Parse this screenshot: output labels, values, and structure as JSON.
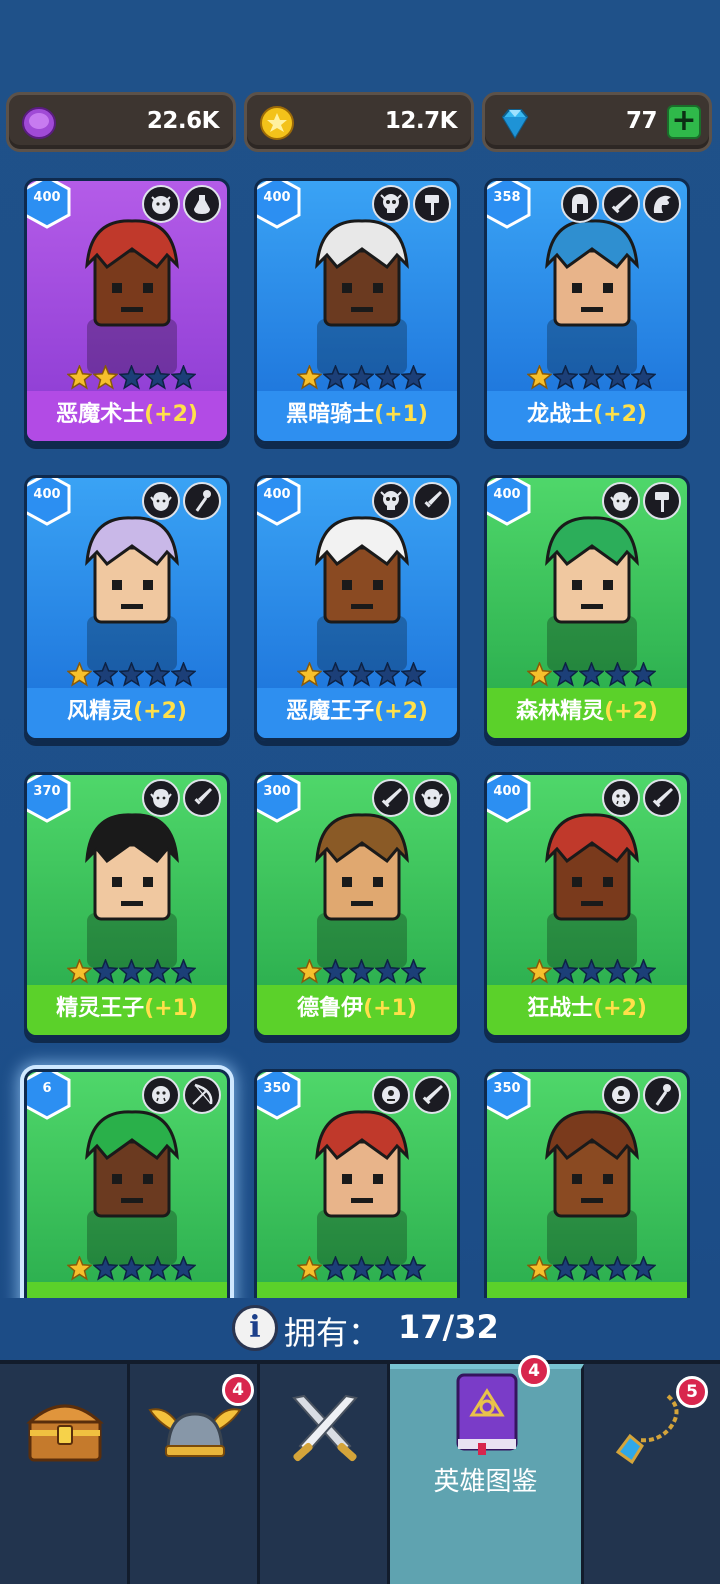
{
  "currencies": {
    "elixir": {
      "icon": "purple-coin-icon",
      "value": "22.6K"
    },
    "gold": {
      "icon": "gold-coin-icon",
      "value": "12.7K"
    },
    "gems": {
      "icon": "diamond-icon",
      "value": "77",
      "plus": "+"
    }
  },
  "heroes": [
    {
      "name": "恶魔术士",
      "bonus": "(+2)",
      "level": "400",
      "stars": 2,
      "color": "purple",
      "badges": [
        "demon-face-icon",
        "potion-icon"
      ]
    },
    {
      "name": "黑暗骑士",
      "bonus": "(+1)",
      "level": "400",
      "stars": 1,
      "color": "blue",
      "badges": [
        "skull-icon",
        "hammer-icon"
      ]
    },
    {
      "name": "龙战士",
      "bonus": "(+2)",
      "level": "358",
      "stars": 1,
      "color": "blue",
      "badges": [
        "helmet-icon",
        "sword-icon",
        "dragon-icon"
      ]
    },
    {
      "name": "风精灵",
      "bonus": "(+2)",
      "level": "400",
      "stars": 1,
      "color": "blue",
      "badges": [
        "elf-face-icon",
        "staff-icon"
      ]
    },
    {
      "name": "恶魔王子",
      "bonus": "(+2)",
      "level": "400",
      "stars": 1,
      "color": "blue",
      "badges": [
        "skull-icon",
        "dagger-icon"
      ]
    },
    {
      "name": "森林精灵",
      "bonus": "(+2)",
      "level": "400",
      "stars": 1,
      "color": "green",
      "badges": [
        "elf-face-icon",
        "hammer-icon"
      ]
    },
    {
      "name": "精灵王子",
      "bonus": "(+1)",
      "level": "370",
      "stars": 1,
      "color": "green",
      "badges": [
        "elf-face-icon",
        "dagger-icon"
      ]
    },
    {
      "name": "德鲁伊",
      "bonus": "(+1)",
      "level": "300",
      "stars": 1,
      "color": "green",
      "badges": [
        "sword-icon",
        "elf-face-icon"
      ]
    },
    {
      "name": "狂战士",
      "bonus": "(+2)",
      "level": "400",
      "stars": 1,
      "color": "green",
      "badges": [
        "orc-face-icon",
        "sword-icon"
      ]
    },
    {
      "name": "",
      "bonus": "",
      "level": "6",
      "stars": 1,
      "color": "green",
      "badges": [
        "orc-face-icon",
        "bow-icon"
      ],
      "selected": true
    },
    {
      "name": "",
      "bonus": "",
      "level": "350",
      "stars": 1,
      "color": "green",
      "badges": [
        "cyclops-face-icon",
        "sword-icon"
      ]
    },
    {
      "name": "",
      "bonus": "",
      "level": "350",
      "stars": 1,
      "color": "green",
      "badges": [
        "cyclops-face-icon",
        "staff-icon"
      ]
    }
  ],
  "owned": {
    "label": "拥有：",
    "value": "17/32"
  },
  "nav": {
    "items": [
      {
        "icon": "treasure-chest-icon",
        "badge": ""
      },
      {
        "icon": "winged-helmet-icon",
        "badge": "4"
      },
      {
        "icon": "crossed-swords-icon",
        "badge": ""
      },
      {
        "icon": "hero-book-icon",
        "badge": "4",
        "label": "英雄图鉴",
        "active": true
      },
      {
        "icon": "amulet-icon",
        "badge": "5"
      }
    ]
  }
}
